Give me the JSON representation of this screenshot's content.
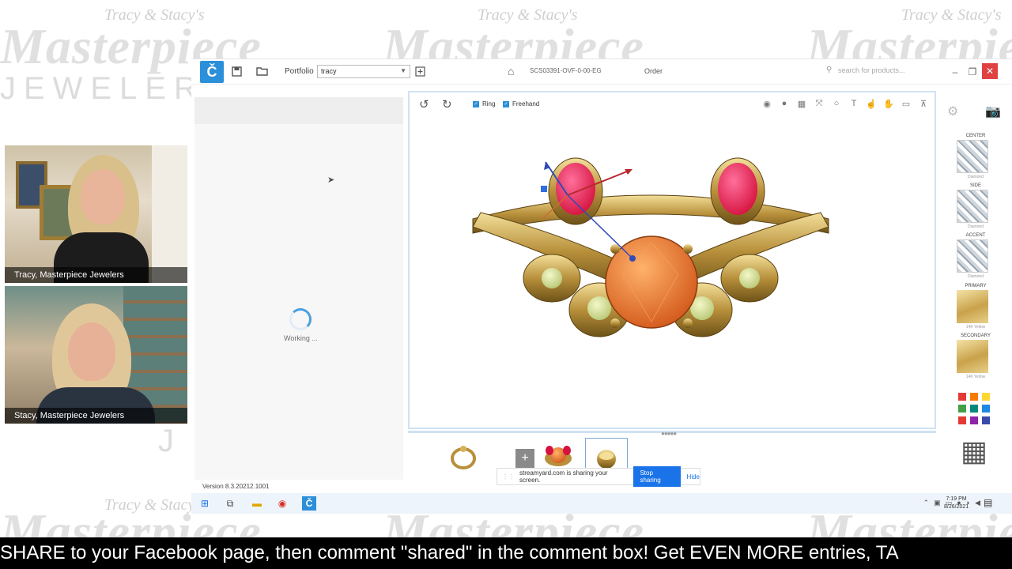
{
  "watermark": {
    "owner": "Tracy & Stacy's",
    "brand": "Masterpiece",
    "jewelers": "JEWELERS",
    "initial": "J"
  },
  "app": {
    "logo_glyph": "Č",
    "portfolio_label": "Portfolio",
    "portfolio_value": "tracy",
    "sku": "SCS03391-OVF-0-00-EG",
    "order_label": "Order",
    "search_placeholder": "search for products...",
    "working_text": "Working ...",
    "version": "Version 8.3.20212.1001",
    "colors": {
      "accent": "#2b8fd9",
      "close": "#e04141"
    }
  },
  "viewport": {
    "ring_label": "Ring",
    "freehand_label": "Freehand"
  },
  "right_panel": {
    "slots": [
      {
        "label": "CENTER",
        "sub": "Diamond",
        "type": "diamond"
      },
      {
        "label": "SIDE",
        "sub": "Diamond",
        "type": "diamond"
      },
      {
        "label": "ACCENT",
        "sub": "Diamond",
        "type": "diamond"
      },
      {
        "label": "PRIMARY",
        "sub": "14K Yellow",
        "type": "gold"
      },
      {
        "label": "SECONDARY",
        "sub": "14K Yellow",
        "type": "gold"
      }
    ],
    "palette": [
      "#e53935",
      "#f57c00",
      "#fdd835",
      "#43a047",
      "#00897b",
      "#1e88e5",
      "#e53935",
      "#8e24aa",
      "#3949ab"
    ]
  },
  "share_bar": {
    "message": "streamyard.com is sharing your screen.",
    "stop_label": "Stop sharing",
    "hide_label": "Hide"
  },
  "taskbar": {
    "time": "7:19 PM",
    "date": "8/26/2021"
  },
  "cams": [
    {
      "name": "Tracy, Masterpiece Jewelers"
    },
    {
      "name": "Stacy, Masterpiece Jewelers"
    }
  ],
  "ticker": "SHARE to your Facebook page, then comment \"shared\" in the comment box! Get EVEN MORE entries, TA"
}
